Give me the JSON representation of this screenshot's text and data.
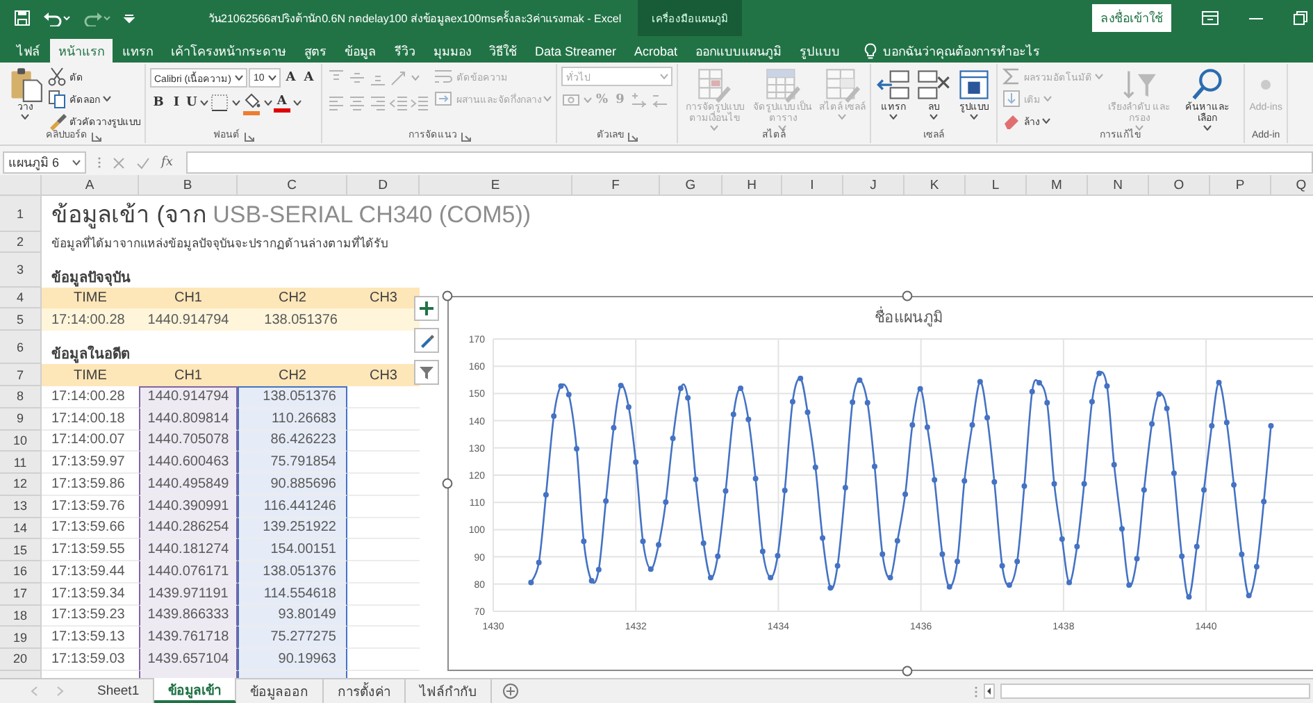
{
  "title_bar": {
    "title": "วัน21062566สปริงต้านัก0.6N กดdelay100 ส่งข้อมูลex100msครั้งละ3ค่าแรงmak - Excel",
    "context_label": "เครื่องมือแผนภูมิ",
    "sign_in": "ลงชื่อเข้าใช้"
  },
  "tabs": [
    {
      "label": "ไฟล์",
      "selected": false
    },
    {
      "label": "หน้าแรก",
      "selected": true
    },
    {
      "label": "แทรก",
      "selected": false
    },
    {
      "label": "เค้าโครงหน้ากระดาษ",
      "selected": false
    },
    {
      "label": "สูตร",
      "selected": false
    },
    {
      "label": "ข้อมูล",
      "selected": false
    },
    {
      "label": "รีวิว",
      "selected": false
    },
    {
      "label": "มุมมอง",
      "selected": false
    },
    {
      "label": "วิธีใช้",
      "selected": false
    },
    {
      "label": "Data Streamer",
      "selected": false
    },
    {
      "label": "Acrobat",
      "selected": false
    },
    {
      "label": "ออกแบบแผนภูมิ",
      "selected": false
    },
    {
      "label": "รูปแบบ",
      "selected": false
    }
  ],
  "tell_me": "บอกฉันว่าคุณต้องการทำอะไร",
  "ribbon": {
    "groups": [
      {
        "label": "คลิปบอร์ด",
        "launcher": true,
        "stacks": [
          [
            [
              {
                "kind": "large",
                "label": "วาง",
                "menu": true,
                "disabled": false
              }
            ]
          ],
          [
            [
              {
                "kind": "small",
                "label": "ตัด",
                "menu": false,
                "disabled": false
              }
            ],
            [
              {
                "kind": "small",
                "label": "คัดลอก",
                "menu": true,
                "disabled": false
              }
            ],
            [
              {
                "kind": "small",
                "label": "ตัวคัดวางรูปแบบ",
                "menu": false,
                "disabled": false
              }
            ]
          ]
        ]
      },
      {
        "label": "ฟอนต์",
        "launcher": true,
        "stacks": [
          [
            [
              {
                "kind": "field",
                "label": "Calibri (เนื้อความ)",
                "menu": true,
                "disabled": false
              },
              {
                "kind": "field",
                "label": "10",
                "menu": true,
                "disabled": false
              },
              {
                "kind": "tool",
                "label": "A",
                "menu": false,
                "disabled": false
              },
              {
                "kind": "tool",
                "label": "A",
                "menu": false,
                "disabled": false
              }
            ],
            [
              {
                "kind": "tool",
                "label": "B",
                "menu": false,
                "disabled": false
              },
              {
                "kind": "tool",
                "label": "I",
                "menu": false,
                "disabled": false
              },
              {
                "kind": "tool",
                "label": "U",
                "menu": true,
                "disabled": false
              },
              {
                "kind": "tool",
                "menu": true,
                "disabled": false
              },
              {
                "kind": "tool",
                "menu": true,
                "disabled": false,
                "color": "#ed7d31"
              },
              {
                "kind": "tool",
                "label": "A",
                "menu": true,
                "disabled": false,
                "color": "#e00000"
              }
            ]
          ]
        ]
      },
      {
        "label": "การจัดแนว",
        "launcher": true,
        "stacks": [
          [
            [
              {
                "kind": "tool",
                "menu": false,
                "disabled": true
              },
              {
                "kind": "tool",
                "menu": false,
                "disabled": true
              },
              {
                "kind": "tool",
                "menu": false,
                "disabled": true
              },
              {
                "kind": "tool",
                "menu": true,
                "disabled": true
              }
            ],
            [
              {
                "kind": "tool",
                "menu": false,
                "disabled": true
              },
              {
                "kind": "tool",
                "menu": false,
                "disabled": true
              },
              {
                "kind": "tool",
                "menu": false,
                "disabled": true
              },
              {
                "kind": "tool",
                "menu": false,
                "disabled": true
              },
              {
                "kind": "tool",
                "menu": false,
                "disabled": true
              }
            ]
          ],
          [
            [
              {
                "kind": "small",
                "label": "ตัดข้อความ",
                "menu": false,
                "disabled": true
              }
            ],
            [
              {
                "kind": "small",
                "label": "ผสานและจัดกึ่งกลาง",
                "menu": true,
                "disabled": true
              }
            ]
          ]
        ]
      },
      {
        "label": "ตัวเลข",
        "launcher": true,
        "stacks": [
          [
            [
              {
                "kind": "combo",
                "label": "ทั่วไป",
                "menu": true,
                "disabled": true
              }
            ],
            [
              {
                "kind": "tool",
                "menu": true,
                "disabled": true
              },
              {
                "kind": "tool",
                "label": "%",
                "menu": false,
                "disabled": true
              },
              {
                "kind": "tool",
                "label": "9",
                "menu": false,
                "disabled": true
              },
              {
                "kind": "tool",
                "menu": false,
                "disabled": true
              },
              {
                "kind": "tool",
                "menu": false,
                "disabled": true
              }
            ]
          ]
        ]
      },
      {
        "label": "สไตล์",
        "launcher": false,
        "stacks": [
          [
            [
              {
                "kind": "large",
                "label": "การจัดรูปแบบ ตามเงื่อนไข",
                "menu": true,
                "disabled": true
              }
            ]
          ],
          [
            [
              {
                "kind": "large",
                "label": "จัดรูปแบบ เป็นตาราง",
                "menu": true,
                "disabled": true
              }
            ]
          ],
          [
            [
              {
                "kind": "large",
                "label": "สไตล์ เซลล์",
                "menu": true,
                "disabled": true
              }
            ]
          ]
        ]
      },
      {
        "label": "เซลล์",
        "launcher": false,
        "stacks": [
          [
            [
              {
                "kind": "large",
                "label": "แทรก",
                "menu": true,
                "disabled": false
              }
            ]
          ],
          [
            [
              {
                "kind": "large",
                "label": "ลบ",
                "menu": true,
                "disabled": false
              }
            ]
          ],
          [
            [
              {
                "kind": "large",
                "label": "รูปแบบ",
                "menu": true,
                "disabled": false
              }
            ]
          ]
        ]
      },
      {
        "label": "การแก้ไข",
        "launcher": false,
        "stacks": [
          [
            [
              {
                "kind": "small",
                "label": "ผลรวมอัตโนมัติ",
                "menu": true,
                "disabled": true
              }
            ],
            [
              {
                "kind": "small",
                "label": "เติม",
                "menu": true,
                "disabled": true
              }
            ],
            [
              {
                "kind": "small",
                "label": "ล้าง",
                "menu": true,
                "disabled": false
              }
            ]
          ],
          [
            [
              {
                "kind": "large",
                "label": "เรียงลำดับ และกรอง",
                "menu": true,
                "disabled": true
              }
            ]
          ],
          [
            [
              {
                "kind": "large",
                "label": "ค้นหาและ เลือก",
                "menu": true,
                "disabled": false
              }
            ]
          ]
        ]
      },
      {
        "label": "Add-in",
        "launcher": false,
        "stacks": [
          [
            [
              {
                "kind": "large",
                "label": "Add-ins",
                "menu": false,
                "disabled": true
              }
            ]
          ]
        ]
      }
    ]
  },
  "formula_bar": {
    "name_box": "แผนภูมิ 6",
    "function_label": "fx"
  },
  "sheet": {
    "column_headers": [
      "A",
      "B",
      "C",
      "D",
      "E",
      "F",
      "G",
      "H",
      "I",
      "J",
      "K",
      "L",
      "M",
      "N",
      "O",
      "P",
      "Q"
    ],
    "row_headers": [
      "1",
      "2",
      "3",
      "4",
      "5",
      "6",
      "7",
      "8",
      "9",
      "10",
      "11",
      "12",
      "13",
      "14",
      "15",
      "16",
      "17",
      "18",
      "19",
      "20"
    ],
    "title": "**ข้อมูลเข้า (จาก** USB-SERIAL CH340 (COM5))",
    "subtitle": "ข้อมูลที่ได้มาจากแหล่งข้อมูลปัจจุบันจะปรากฏด้านล่างตามที่ได้รับ",
    "current": {
      "heading": "ข้อมูลปัจจุบัน",
      "columns": [
        {
          "label": "TIME"
        },
        {
          "label": "CH1"
        },
        {
          "label": "CH2"
        },
        {
          "label": "CH3"
        }
      ],
      "rows": [
        [
          "17:14:00.28",
          "1440.914794",
          "138.051376"
        ]
      ]
    },
    "history": {
      "heading": "ข้อมูลในอดีต",
      "columns": [
        {
          "label": "TIME"
        },
        {
          "label": "CH1",
          "color": "#8064a2"
        },
        {
          "label": "CH2",
          "color": "#4472c4"
        },
        {
          "label": "CH3"
        }
      ],
      "rows": [
        [
          "17:14:00.28",
          "1440.914794",
          "138.051376"
        ],
        [
          "17:14:00.18",
          "1440.809814",
          "110.26683"
        ],
        [
          "17:14:00.07",
          "1440.705078",
          "86.426223"
        ],
        [
          "17:13:59.97",
          "1440.600463",
          "75.791854"
        ],
        [
          "17:13:59.86",
          "1440.495849",
          "90.885696"
        ],
        [
          "17:13:59.76",
          "1440.390991",
          "116.441246"
        ],
        [
          "17:13:59.66",
          "1440.286254",
          "139.251922"
        ],
        [
          "17:13:59.55",
          "1440.181274",
          "154.00151"
        ],
        [
          "17:13:59.44",
          "1440.076171",
          "138.051376"
        ],
        [
          "17:13:59.34",
          "1439.971191",
          "114.554618"
        ],
        [
          "17:13:59.23",
          "1439.866333",
          "93.80149"
        ],
        [
          "17:13:59.13",
          "1439.761718",
          "75.277275"
        ],
        [
          "17:13:59.03",
          "1439.657104",
          "90.19963"
        ]
      ]
    },
    "chart": {
      "chart_data": {
        "type": "line",
        "title": "ชื่อแผนภูมิ",
        "x": [
          1430.53,
          1430.64,
          1430.74,
          1430.85,
          1430.95,
          1431.06,
          1431.17,
          1431.27,
          1431.38,
          1431.48,
          1431.58,
          1431.69,
          1431.79,
          1431.9,
          1432.0,
          1432.1,
          1432.21,
          1432.32,
          1432.42,
          1432.52,
          1432.63,
          1432.73,
          1432.84,
          1432.95,
          1433.05,
          1433.15,
          1433.26,
          1433.37,
          1433.47,
          1433.58,
          1433.68,
          1433.78,
          1433.89,
          1433.99,
          1434.09,
          1434.2,
          1434.31,
          1434.41,
          1434.52,
          1434.62,
          1434.73,
          1434.83,
          1434.94,
          1435.04,
          1435.14,
          1435.25,
          1435.35,
          1435.46,
          1435.57,
          1435.67,
          1435.78,
          1435.88,
          1435.99,
          1436.09,
          1436.19,
          1436.3,
          1436.4,
          1436.51,
          1436.61,
          1436.72,
          1436.83,
          1436.93,
          1437.03,
          1437.14,
          1437.24,
          1437.35,
          1437.45,
          1437.56,
          1437.66,
          1437.77,
          1437.87,
          1437.98,
          1438.08,
          1438.19,
          1438.29,
          1438.4,
          1438.5,
          1438.61,
          1438.71,
          1438.82,
          1438.92,
          1439.03,
          1439.13,
          1439.24,
          1439.34,
          1439.45,
          1439.55,
          1439.66,
          1439.76,
          1439.87,
          1439.97,
          1440.08,
          1440.18,
          1440.29,
          1440.39,
          1440.5,
          1440.6,
          1440.71,
          1440.81,
          1440.91
        ],
        "series": [
          {
            "color": "#4472c4",
            "marker": true,
            "values": [
              80.6,
              87.9,
              112.8,
              141.7,
              152.7,
              149.6,
              129.7,
              95.7,
              81.2,
              85.3,
              110.5,
              137.4,
              152.9,
              145,
              124.8,
              95.7,
              85.5,
              94.4,
              110.1,
              133.5,
              151.9,
              148.4,
              118.5,
              95.0,
              82.4,
              90.2,
              114.2,
              142.3,
              151.9,
              140.5,
              118.7,
              92.0,
              82.4,
              90.4,
              114.4,
              147.0,
              155.5,
              143.1,
              122.9,
              96.9,
              78.6,
              86.7,
              115.4,
              146.8,
              154.9,
              146.6,
              123.2,
              91.0,
              82.4,
              95.9,
              113.0,
              138.4,
              151.7,
              137.6,
              118.3,
              91.0,
              79.0,
              88.3,
              117.9,
              138.4,
              154.3,
              141.1,
              117.5,
              86.7,
              79.6,
              88.3,
              116.0,
              150.7,
              153.9,
              146.6,
              116.8,
              96.5,
              80.6,
              93.8,
              116.8,
              147.0,
              157.4,
              152.7,
              123.8,
              100.3,
              79.6,
              89.3,
              114.6,
              138.8,
              149.8,
              144.5,
              120.7,
              90.2,
              75.3,
              93.8,
              114.6,
              138.1,
              154.0,
              139.3,
              116.4,
              90.9,
              75.8,
              86.4,
              110.3,
              138.1
            ]
          }
        ],
        "grid": true,
        "xlim": [
          1430,
          1441.5
        ],
        "ylim": [
          70,
          170
        ],
        "xticks": [
          1430,
          1432,
          1434,
          1436,
          1438,
          1440
        ],
        "yticks": [
          70,
          80,
          90,
          100,
          110,
          120,
          130,
          140,
          150,
          160,
          170
        ]
      }
    }
  },
  "sheet_tabs": [
    {
      "label": "Sheet1",
      "selected": false
    },
    {
      "label": "ข้อมูลเข้า",
      "selected": true
    },
    {
      "label": "ข้อมูลออก",
      "selected": false
    },
    {
      "label": "การตั้งค่า",
      "selected": false
    },
    {
      "label": "ไฟล์กำกับ",
      "selected": false
    }
  ]
}
